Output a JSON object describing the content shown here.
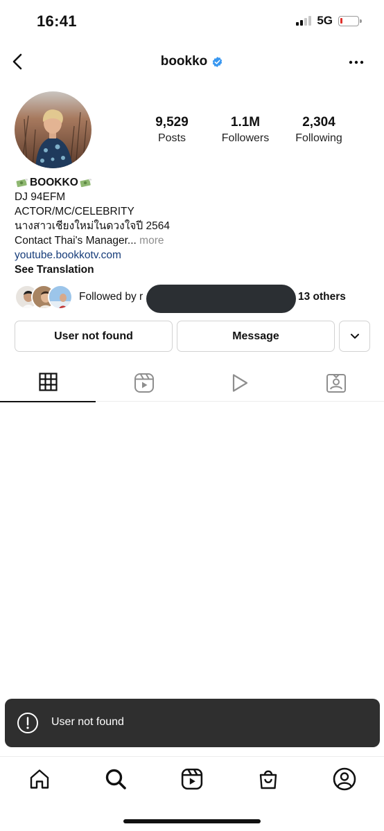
{
  "status_bar": {
    "time": "16:41",
    "network": "5G",
    "signal_bars_active": 2,
    "battery_level": 0.15,
    "battery_color": "#e0312b"
  },
  "header": {
    "username": "bookko",
    "verified": true,
    "back_icon": "chevron-left-icon",
    "more_icon": "more-horizontal-icon"
  },
  "stats": [
    {
      "value": "9,529",
      "label": "Posts"
    },
    {
      "value": "1.1M",
      "label": "Followers"
    },
    {
      "value": "2,304",
      "label": "Following"
    }
  ],
  "bio": {
    "display_name": "BOOKKO",
    "lines": [
      "DJ 94EFM",
      "ACTOR/MC/CELEBRITY",
      "นางสาวเชียงใหม่ในดวงใจปี 2564"
    ],
    "truncated_line": "Contact Thai's Manager...",
    "more_label": "more",
    "link": "youtube.bookkotv.com",
    "see_translation": "See Translation"
  },
  "followed_by": {
    "prefix": "Followed by r",
    "suffix": "13 others"
  },
  "buttons": {
    "user_not_found": "User not found",
    "message": "Message"
  },
  "tabs": [
    {
      "icon": "grid-icon",
      "active": true
    },
    {
      "icon": "reels-icon",
      "active": false
    },
    {
      "icon": "play-icon",
      "active": false
    },
    {
      "icon": "tagged-icon",
      "active": false
    }
  ],
  "toast": {
    "text": "User not found",
    "icon": "alert-circle-icon"
  },
  "bottom_nav": [
    "home-icon",
    "search-icon",
    "reels-icon",
    "shop-icon",
    "profile-icon"
  ],
  "colors": {
    "verified_blue": "#3897f0",
    "link_blue": "#173d7a",
    "toast_bg": "#2f2f2f"
  }
}
